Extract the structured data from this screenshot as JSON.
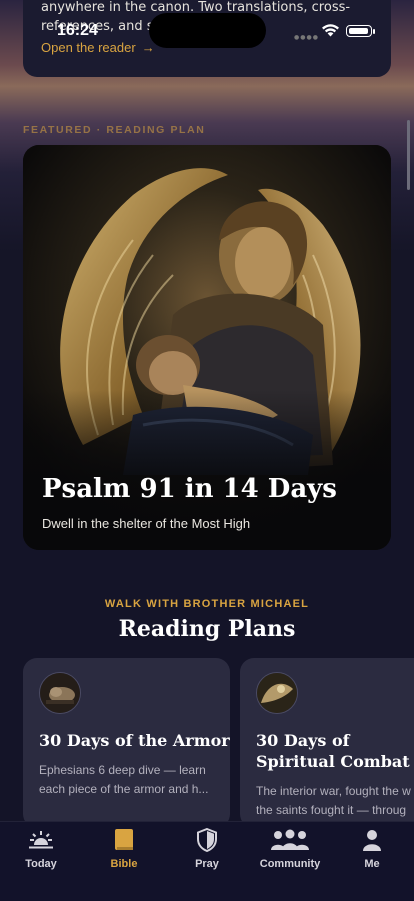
{
  "status_bar": {
    "time": "16:24"
  },
  "top_card": {
    "description_lines": [
      "anywhere in the canon. Two translations, cross-",
      "references, and se                      hole Bible."
    ],
    "open_link": "Open the reader",
    "open_link_arrow": "→"
  },
  "featured": {
    "section_label": "FEATURED · READING PLAN",
    "title": "Psalm 91 in 14 Days",
    "subtitle": "Dwell in the shelter of the Most High"
  },
  "plans": {
    "kicker": "WALK WITH BROTHER MICHAEL",
    "title": "Reading Plans",
    "items": [
      {
        "title": "30 Days of the Armor",
        "description_lines": [
          "Ephesians 6 deep dive — learn",
          "each piece of the armor and h..."
        ]
      },
      {
        "title_lines": [
          "30 Days of",
          "Spiritual Combat"
        ],
        "description_lines": [
          "The interior war, fought the w",
          "the saints fought it — throug"
        ]
      }
    ]
  },
  "tabbar": {
    "items": [
      {
        "label": "Today",
        "icon": "sunrise-icon"
      },
      {
        "label": "Bible",
        "icon": "book-icon",
        "active": true
      },
      {
        "label": "Pray",
        "icon": "shield-icon"
      },
      {
        "label": "Community",
        "icon": "people-icon"
      },
      {
        "label": "Me",
        "icon": "person-icon"
      }
    ]
  },
  "colors": {
    "accent": "#d9a441",
    "background": "#141428",
    "card": "#2b2b40"
  }
}
